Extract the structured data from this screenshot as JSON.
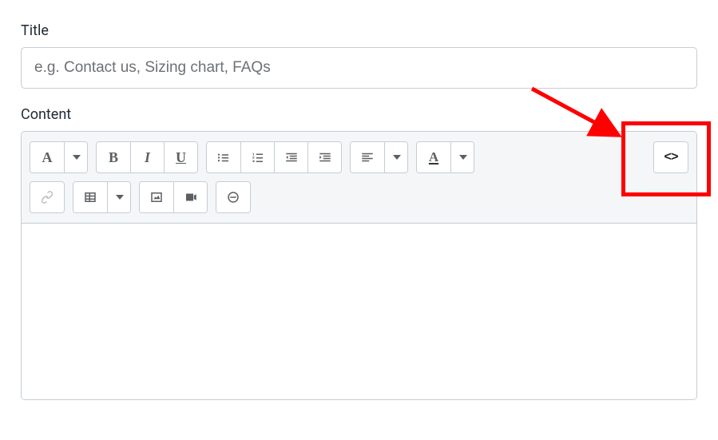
{
  "title": {
    "label": "Title",
    "placeholder": "e.g. Contact us, Sizing chart, FAQs",
    "value": ""
  },
  "content": {
    "label": "Content"
  },
  "toolbar": {
    "paragraph_label": "A",
    "bold_label": "B",
    "italic_label": "I",
    "underline_label": "U",
    "color_label": "A",
    "html_label": "<>"
  },
  "annotation": {
    "highlight_color": "#ff0000",
    "arrow_color": "#ff0000"
  }
}
